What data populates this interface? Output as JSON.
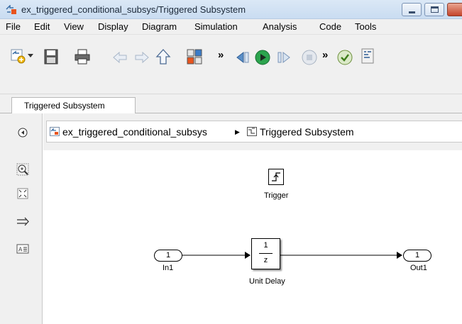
{
  "window": {
    "title": "ex_triggered_conditional_subsys/Triggered Subsystem"
  },
  "menu": {
    "items": [
      "File",
      "Edit",
      "View",
      "Display",
      "Diagram",
      "Simulation",
      "Analysis",
      "Code",
      "Tools"
    ]
  },
  "toolbar": {
    "overflow_glyph_1": "»",
    "overflow_glyph_2": "»"
  },
  "tabs": {
    "active": "Triggered Subsystem"
  },
  "address": {
    "model": "ex_triggered_conditional_subsys",
    "separator": "▶",
    "subsystem": "Triggered Subsystem"
  },
  "diagram": {
    "trigger_label": "Trigger",
    "inport_number": "1",
    "inport_name": "In1",
    "unit_delay_numerator": "1",
    "unit_delay_denominator": "z",
    "unit_delay_name": "Unit Delay",
    "outport_number": "1",
    "outport_name": "Out1"
  },
  "colors": {
    "title_gradient_top": "#dbe8f6",
    "title_gradient_bottom": "#c9dcf1",
    "chrome": "#f0f0f0",
    "run_green": "#2ca44e",
    "close_red": "#c4452c"
  },
  "icons": {
    "title": "simulink-subsystem-icon",
    "toolbar": [
      "new-model-icon",
      "dropdown-arrow-icon",
      "save-icon",
      "print-icon",
      "back-arrow-icon",
      "forward-arrow-icon",
      "up-arrow-icon",
      "library-browser-icon",
      "step-back-icon",
      "run-icon",
      "step-forward-icon",
      "stop-icon",
      "check-icon",
      "build-icon"
    ],
    "palette": [
      "hide-browser-icon",
      "zoom-icon",
      "fit-view-icon",
      "route-lines-icon",
      "annotation-icon"
    ]
  }
}
